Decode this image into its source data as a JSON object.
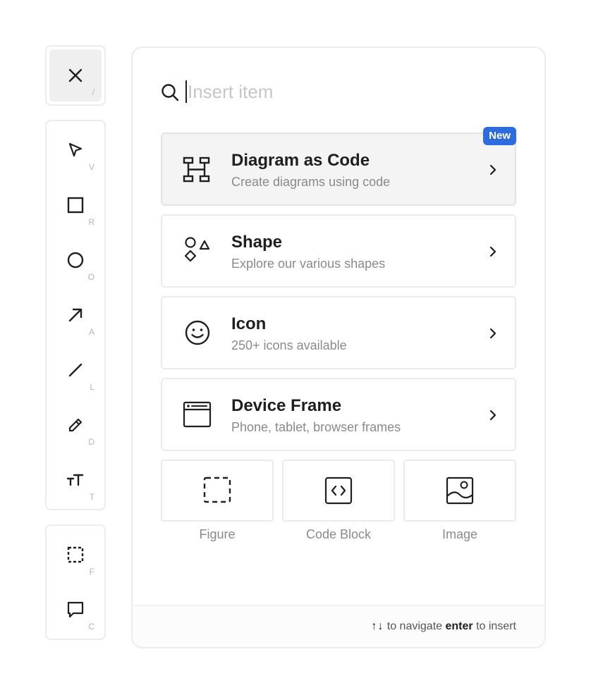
{
  "toolbar": {
    "close": {
      "icon": "close-icon",
      "shortcut": "/"
    },
    "tools": [
      {
        "name": "select",
        "icon": "cursor-arrow-icon",
        "shortcut": "V"
      },
      {
        "name": "rectangle",
        "icon": "square-icon",
        "shortcut": "R"
      },
      {
        "name": "ellipse",
        "icon": "circle-icon",
        "shortcut": "O"
      },
      {
        "name": "arrow",
        "icon": "arrow-icon",
        "shortcut": "A"
      },
      {
        "name": "line",
        "icon": "line-icon",
        "shortcut": "L"
      },
      {
        "name": "draw",
        "icon": "pencil-icon",
        "shortcut": "D"
      },
      {
        "name": "text",
        "icon": "text-size-icon",
        "shortcut": "T"
      }
    ],
    "extras": [
      {
        "name": "figure",
        "icon": "dashed-frame-icon",
        "shortcut": "F"
      },
      {
        "name": "comment",
        "icon": "comment-icon",
        "shortcut": "C"
      }
    ]
  },
  "insert_panel": {
    "search": {
      "placeholder": "Insert item",
      "value": ""
    },
    "items": [
      {
        "title": "Diagram as Code",
        "description": "Create diagrams using code",
        "icon": "diagram-code-icon",
        "badge": "New",
        "highlighted": true
      },
      {
        "title": "Shape",
        "description": "Explore our various shapes",
        "icon": "shapes-icon"
      },
      {
        "title": "Icon",
        "description": "250+ icons available",
        "icon": "smiley-icon"
      },
      {
        "title": "Device Frame",
        "description": "Phone, tablet, browser frames",
        "icon": "browser-window-icon"
      }
    ],
    "tiles": [
      {
        "label": "Figure",
        "icon": "dashed-frame-icon"
      },
      {
        "label": "Code Block",
        "icon": "code-block-icon"
      },
      {
        "label": "Image",
        "icon": "image-icon"
      }
    ],
    "footer": {
      "arrows": "↑↓",
      "navigate_text": "to navigate",
      "enter_key": "enter",
      "insert_text": "to insert"
    }
  },
  "colors": {
    "accent": "#2d6cdf",
    "border": "#ececec",
    "muted_text": "#8a8a8a",
    "active_bg": "#efefef"
  }
}
